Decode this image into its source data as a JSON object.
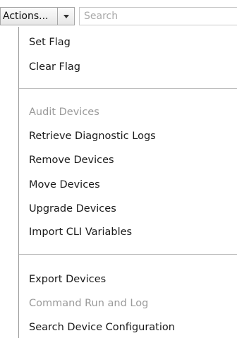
{
  "toolbar": {
    "actions_label": "Actions...",
    "dropdown_icon": "chevron-down-icon",
    "search_placeholder": "Search",
    "search_value": ""
  },
  "menu": {
    "group1": [
      {
        "label": "Set Flag",
        "enabled": true
      },
      {
        "label": "Clear Flag",
        "enabled": true
      }
    ],
    "group2": [
      {
        "label": "Audit Devices",
        "enabled": false
      },
      {
        "label": "Retrieve Diagnostic Logs",
        "enabled": true
      },
      {
        "label": "Remove Devices",
        "enabled": true
      },
      {
        "label": "Move Devices",
        "enabled": true
      },
      {
        "label": "Upgrade Devices",
        "enabled": true
      },
      {
        "label": "Import CLI Variables",
        "enabled": true
      }
    ],
    "group3": [
      {
        "label": "Export Devices",
        "enabled": true
      },
      {
        "label": "Command Run and Log",
        "enabled": false
      },
      {
        "label": "Search Device Configuration",
        "enabled": true
      }
    ]
  },
  "colors": {
    "text": "#1a1a1a",
    "disabled_text": "#9a9a9a",
    "separator": "#bdbdbd",
    "menu_border": "#9a9a9a"
  }
}
